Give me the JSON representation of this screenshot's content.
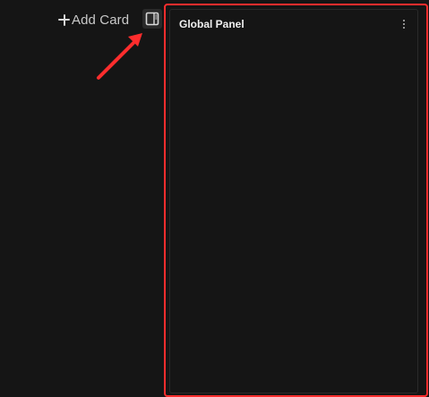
{
  "toolbar": {
    "add_card_label": "Add Card",
    "add_icon": "plus-icon",
    "panel_toggle_icon": "sidebar-panel-icon"
  },
  "panel": {
    "title": "Global Panel",
    "menu_icon": "more-vertical-icon"
  },
  "annotation": {
    "color": "#ff2d2d"
  },
  "colors": {
    "background": "#151515",
    "panel_border": "#2a2a2a",
    "highlight": "#ff2d2d"
  }
}
